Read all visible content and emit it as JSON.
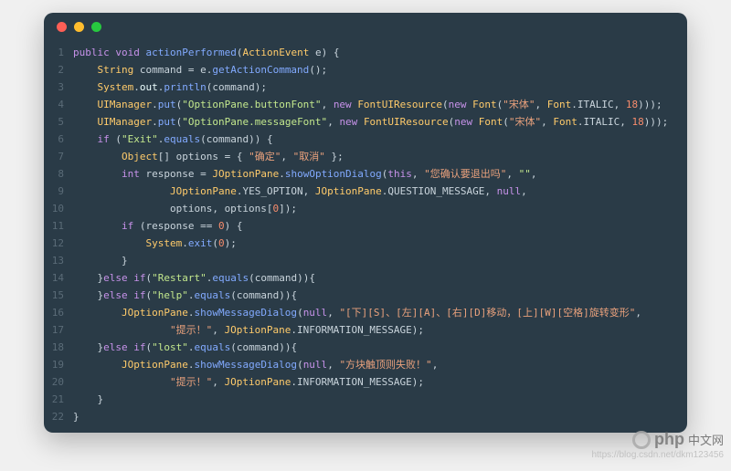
{
  "theme": {
    "bg": "#2a3b47",
    "gutter": "#5a6b77",
    "plain": "#c9d4dc",
    "keyword": "#c792ea",
    "type": "#ffcb6b",
    "method": "#82aaff",
    "string": "#c3e88d",
    "chinese": "#e9a17c",
    "number": "#f78c6c",
    "param": "#eeffff",
    "dot_red": "#ff5f56",
    "dot_yellow": "#ffbd2e",
    "dot_green": "#27c93f"
  },
  "code": {
    "lines": [
      [
        [
          "keyword",
          "public"
        ],
        [
          "plain",
          " "
        ],
        [
          "keyword",
          "void"
        ],
        [
          "plain",
          " "
        ],
        [
          "method",
          "actionPerformed"
        ],
        [
          "plain",
          "("
        ],
        [
          "type",
          "ActionEvent"
        ],
        [
          "plain",
          " e) {"
        ]
      ],
      [
        [
          "plain",
          "    "
        ],
        [
          "type",
          "String"
        ],
        [
          "plain",
          " command = e."
        ],
        [
          "method",
          "getActionCommand"
        ],
        [
          "plain",
          "();"
        ]
      ],
      [
        [
          "plain",
          "    "
        ],
        [
          "type",
          "System"
        ],
        [
          "plain",
          "."
        ],
        [
          "param",
          "out"
        ],
        [
          "plain",
          "."
        ],
        [
          "method",
          "println"
        ],
        [
          "plain",
          "(command);"
        ]
      ],
      [
        [
          "plain",
          "    "
        ],
        [
          "type",
          "UIManager"
        ],
        [
          "plain",
          "."
        ],
        [
          "method",
          "put"
        ],
        [
          "plain",
          "("
        ],
        [
          "string",
          "\"OptionPane.buttonFont\""
        ],
        [
          "plain",
          ", "
        ],
        [
          "keyword",
          "new"
        ],
        [
          "plain",
          " "
        ],
        [
          "type",
          "FontUIResource"
        ],
        [
          "plain",
          "("
        ],
        [
          "keyword",
          "new"
        ],
        [
          "plain",
          " "
        ],
        [
          "type",
          "Font"
        ],
        [
          "plain",
          "("
        ],
        [
          "chinese",
          "\"宋体\""
        ],
        [
          "plain",
          ", "
        ],
        [
          "type",
          "Font"
        ],
        [
          "plain",
          ".ITALIC, "
        ],
        [
          "number",
          "18"
        ],
        [
          "plain",
          ")));"
        ]
      ],
      [
        [
          "plain",
          "    "
        ],
        [
          "type",
          "UIManager"
        ],
        [
          "plain",
          "."
        ],
        [
          "method",
          "put"
        ],
        [
          "plain",
          "("
        ],
        [
          "string",
          "\"OptionPane.messageFont\""
        ],
        [
          "plain",
          ", "
        ],
        [
          "keyword",
          "new"
        ],
        [
          "plain",
          " "
        ],
        [
          "type",
          "FontUIResource"
        ],
        [
          "plain",
          "("
        ],
        [
          "keyword",
          "new"
        ],
        [
          "plain",
          " "
        ],
        [
          "type",
          "Font"
        ],
        [
          "plain",
          "("
        ],
        [
          "chinese",
          "\"宋体\""
        ],
        [
          "plain",
          ", "
        ],
        [
          "type",
          "Font"
        ],
        [
          "plain",
          ".ITALIC, "
        ],
        [
          "number",
          "18"
        ],
        [
          "plain",
          ")));"
        ]
      ],
      [
        [
          "plain",
          "    "
        ],
        [
          "keyword",
          "if"
        ],
        [
          "plain",
          " ("
        ],
        [
          "string",
          "\"Exit\""
        ],
        [
          "plain",
          "."
        ],
        [
          "method",
          "equals"
        ],
        [
          "plain",
          "(command)) {"
        ]
      ],
      [
        [
          "plain",
          "        "
        ],
        [
          "type",
          "Object"
        ],
        [
          "plain",
          "[] options = { "
        ],
        [
          "chinese",
          "\"确定\""
        ],
        [
          "plain",
          ", "
        ],
        [
          "chinese",
          "\"取消\""
        ],
        [
          "plain",
          " };"
        ]
      ],
      [
        [
          "plain",
          "        "
        ],
        [
          "keyword",
          "int"
        ],
        [
          "plain",
          " response = "
        ],
        [
          "type",
          "JOptionPane"
        ],
        [
          "plain",
          "."
        ],
        [
          "method",
          "showOptionDialog"
        ],
        [
          "plain",
          "("
        ],
        [
          "keyword",
          "this"
        ],
        [
          "plain",
          ", "
        ],
        [
          "chinese",
          "\"您确认要退出吗\""
        ],
        [
          "plain",
          ", "
        ],
        [
          "string",
          "\"\""
        ],
        [
          "plain",
          ","
        ]
      ],
      [
        [
          "plain",
          "                "
        ],
        [
          "type",
          "JOptionPane"
        ],
        [
          "plain",
          ".YES_OPTION, "
        ],
        [
          "type",
          "JOptionPane"
        ],
        [
          "plain",
          ".QUESTION_MESSAGE, "
        ],
        [
          "keyword",
          "null"
        ],
        [
          "plain",
          ","
        ]
      ],
      [
        [
          "plain",
          "                options, options["
        ],
        [
          "number",
          "0"
        ],
        [
          "plain",
          "]);"
        ]
      ],
      [
        [
          "plain",
          "        "
        ],
        [
          "keyword",
          "if"
        ],
        [
          "plain",
          " (response == "
        ],
        [
          "number",
          "0"
        ],
        [
          "plain",
          ") {"
        ]
      ],
      [
        [
          "plain",
          "            "
        ],
        [
          "type",
          "System"
        ],
        [
          "plain",
          "."
        ],
        [
          "method",
          "exit"
        ],
        [
          "plain",
          "("
        ],
        [
          "number",
          "0"
        ],
        [
          "plain",
          ");"
        ]
      ],
      [
        [
          "plain",
          "        }"
        ]
      ],
      [
        [
          "plain",
          "    }"
        ],
        [
          "keyword",
          "else if"
        ],
        [
          "plain",
          "("
        ],
        [
          "string",
          "\"Restart\""
        ],
        [
          "plain",
          "."
        ],
        [
          "method",
          "equals"
        ],
        [
          "plain",
          "(command)){"
        ]
      ],
      [
        [
          "plain",
          "    }"
        ],
        [
          "keyword",
          "else if"
        ],
        [
          "plain",
          "("
        ],
        [
          "string",
          "\"help\""
        ],
        [
          "plain",
          "."
        ],
        [
          "method",
          "equals"
        ],
        [
          "plain",
          "(command)){"
        ]
      ],
      [
        [
          "plain",
          "        "
        ],
        [
          "type",
          "JOptionPane"
        ],
        [
          "plain",
          "."
        ],
        [
          "method",
          "showMessageDialog"
        ],
        [
          "plain",
          "("
        ],
        [
          "keyword",
          "null"
        ],
        [
          "plain",
          ", "
        ],
        [
          "chinese",
          "\"[下][S]、[左][A]、[右][D]移动，[上][W][空格]旋转变形\""
        ],
        [
          "plain",
          ","
        ]
      ],
      [
        [
          "plain",
          "                "
        ],
        [
          "chinese",
          "\"提示！\""
        ],
        [
          "plain",
          ", "
        ],
        [
          "type",
          "JOptionPane"
        ],
        [
          "plain",
          ".INFORMATION_MESSAGE);"
        ]
      ],
      [
        [
          "plain",
          "    }"
        ],
        [
          "keyword",
          "else if"
        ],
        [
          "plain",
          "("
        ],
        [
          "string",
          "\"lost\""
        ],
        [
          "plain",
          "."
        ],
        [
          "method",
          "equals"
        ],
        [
          "plain",
          "(command)){"
        ]
      ],
      [
        [
          "plain",
          "        "
        ],
        [
          "type",
          "JOptionPane"
        ],
        [
          "plain",
          "."
        ],
        [
          "method",
          "showMessageDialog"
        ],
        [
          "plain",
          "("
        ],
        [
          "keyword",
          "null"
        ],
        [
          "plain",
          ", "
        ],
        [
          "chinese",
          "\"方块触顶则失败！\""
        ],
        [
          "plain",
          ","
        ]
      ],
      [
        [
          "plain",
          "                "
        ],
        [
          "chinese",
          "\"提示！\""
        ],
        [
          "plain",
          ", "
        ],
        [
          "type",
          "JOptionPane"
        ],
        [
          "plain",
          ".INFORMATION_MESSAGE);"
        ]
      ],
      [
        [
          "plain",
          "    }"
        ]
      ],
      [
        [
          "plain",
          "}"
        ]
      ]
    ]
  },
  "watermark": {
    "php": "php",
    "cn": "中文网",
    "url": "https://blog.csdn.net/dkm123456"
  }
}
